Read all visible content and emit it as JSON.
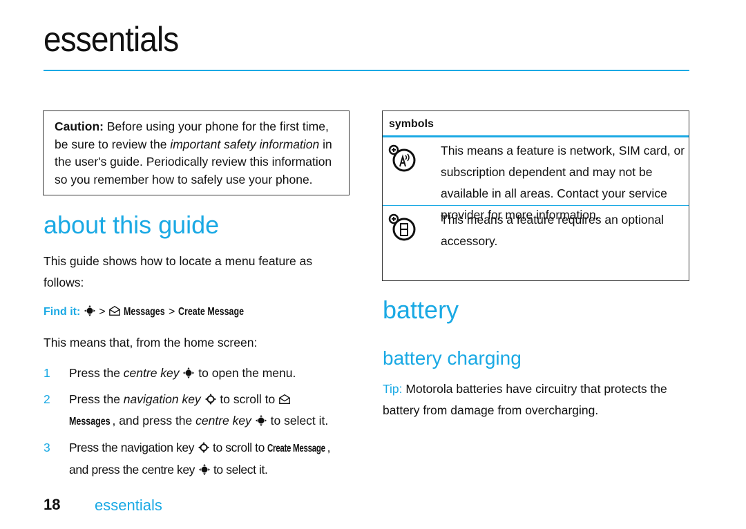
{
  "page": {
    "title": "essentials",
    "accent_color": "#1aa9e4"
  },
  "caution": {
    "label": "Caution:",
    "text_before": " Before using your phone for the first time, be sure to review the ",
    "emphasis": "important safety information",
    "text_after": " in the user's guide. Periodically review this information so you remember how to safely use your phone."
  },
  "about": {
    "heading": "about this guide",
    "intro": "This guide shows how to locate a menu feature as follows:",
    "find_it": {
      "label": "Find it:",
      "sep1": ">",
      "menu1": "Messages",
      "sep2": ">",
      "menu2": "Create Message",
      "icons": [
        "centre-key-icon",
        "messages-icon"
      ]
    },
    "means": "This means that, from the home screen:",
    "steps": [
      {
        "num": "1",
        "a": "Press the ",
        "a_em": "centre key",
        "b": " to open the menu."
      },
      {
        "num": "2",
        "a": "Press the ",
        "a_em": "navigation key",
        "b": " to scroll to ",
        "menu": "Messages",
        "c": ", and press the ",
        "c_em": "centre key",
        "d": " to select it."
      },
      {
        "num": "3",
        "a": "Press the navigation key ",
        "b": " to scroll to ",
        "menu": "Create Message",
        "c": ",",
        "d": "and press the centre key ",
        "e": " to select it."
      }
    ]
  },
  "symbols": {
    "header": "symbols",
    "rows": [
      {
        "icon": "network-dependent-icon",
        "text": "This means a feature is network, SIM card, or subscription dependent and may not be available in all areas. Contact your service provider for more information."
      },
      {
        "icon": "optional-accessory-icon",
        "text": "This means a feature requires an optional accessory."
      }
    ]
  },
  "battery": {
    "heading": "battery",
    "subheading": "battery charging",
    "tip_label": "Tip:",
    "tip_text": " Motorola batteries have circuitry that protects the battery from damage from overcharging."
  },
  "footer": {
    "page_number": "18",
    "section": "essentials"
  }
}
